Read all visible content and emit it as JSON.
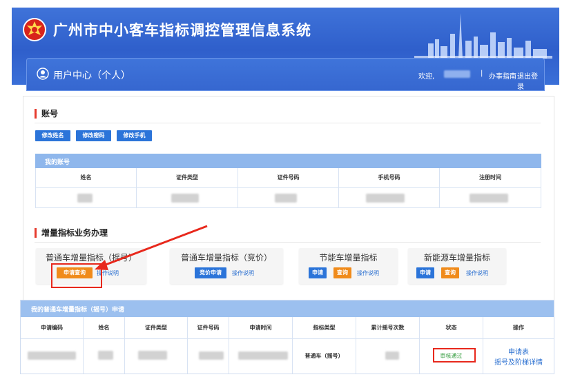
{
  "header": {
    "app_title": "广州市中小客车指标调控管理信息系统",
    "user_center": "用户中心（个人）",
    "welcome": "欢迎,",
    "separator": "|",
    "guide_link": "办事指南",
    "logout_link": "退出登录"
  },
  "account": {
    "section_title": "账号",
    "buttons": [
      "修改姓名",
      "修改密码",
      "修改手机"
    ],
    "table_title": "我的账号",
    "columns": [
      "姓名",
      "证件类型",
      "证件号码",
      "手机号码",
      "注册时间"
    ]
  },
  "business": {
    "section_title": "增量指标业务办理",
    "cards": [
      {
        "title": "普通车增量指标（摇号）",
        "buttons": [
          "申请查询"
        ],
        "link": "操作说明"
      },
      {
        "title": "普通车增量指标（竞价）",
        "buttons": [
          "竞价申请"
        ],
        "link": "操作说明"
      },
      {
        "title": "节能车增量指标",
        "buttons": [
          "申请",
          "查询"
        ],
        "link": "操作说明"
      },
      {
        "title": "新能源车增量指标",
        "buttons": [
          "申请",
          "查询"
        ],
        "link": "操作说明"
      }
    ]
  },
  "application": {
    "table_title": "我的普通车增量指标（摇号）申请",
    "columns": [
      "申请编码",
      "姓名",
      "证件类型",
      "证件号码",
      "申请时间",
      "指标类型",
      "累计摇号次数",
      "状态",
      "操作"
    ],
    "row": {
      "indicator_type": "普通车（摇号）",
      "status": "审核通过",
      "action_1": "申请表",
      "action_2": "摇号及阶梯详情"
    }
  },
  "colors": {
    "header_blue": "#2f5fcb",
    "accent_red": "#e8281c",
    "button_blue": "#2b74d9",
    "button_orange": "#f08b1b",
    "status_green": "#2f9a3a"
  }
}
